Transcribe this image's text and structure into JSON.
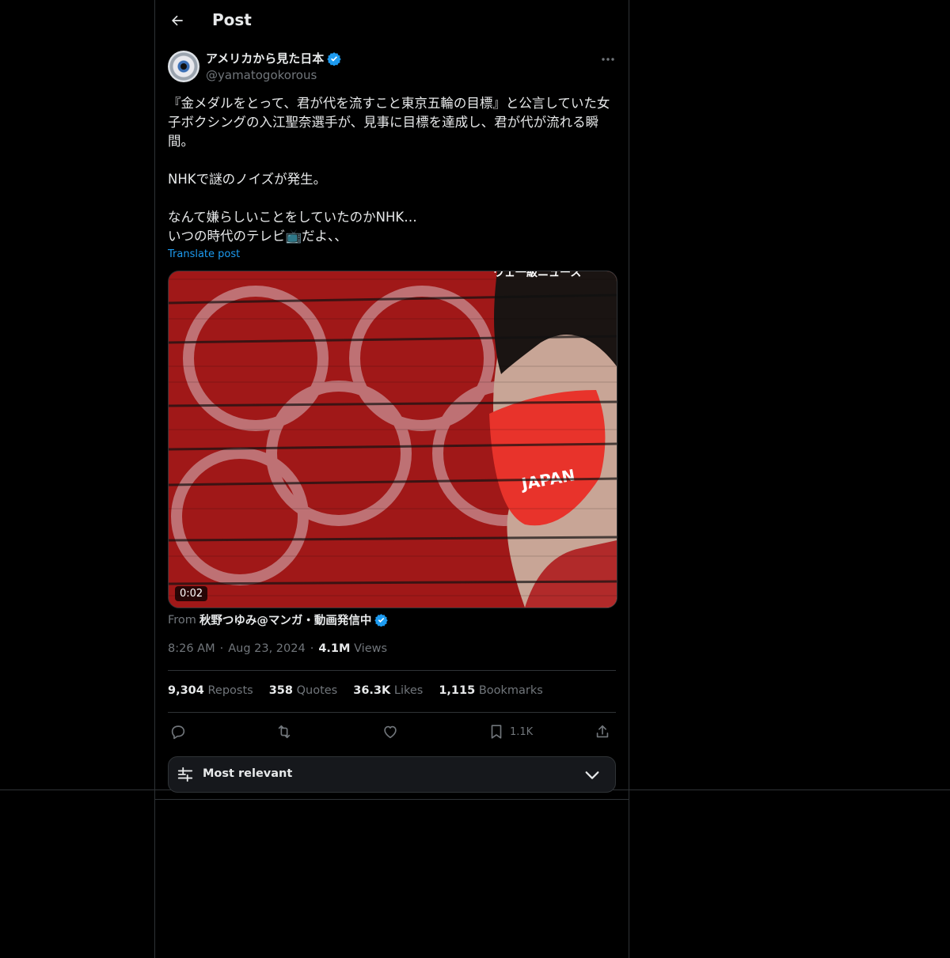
{
  "header": {
    "title": "Post"
  },
  "author": {
    "name": "アメリカから見た日本",
    "handle": "@yamatogokorous",
    "verified": true
  },
  "post": {
    "text": "『金メダルをとって、君が代を流すこと東京五輪の目標』と公言していた女子ボクシングの入江聖奈選手が、見事に目標を達成し、君が代が流れる瞬間。\n\nNHKで謎のノイズが発生。\n\nなんて嫌らしいことをしていたのかNHK…\nいつの時代のテレビ📺だよ、、",
    "translate_label": "Translate post"
  },
  "media": {
    "duration": "0:02",
    "mask_text": "JAPAN",
    "overlay_text": "ウェ一級ニュース"
  },
  "source": {
    "from_label": "From",
    "user": "秋野つゆみ@マンガ・動画発信中",
    "verified": true
  },
  "meta": {
    "time": "8:26 AM",
    "date": "Aug 23, 2024",
    "views_count": "4.1M",
    "views_label": "Views",
    "sep": "·"
  },
  "stats": [
    {
      "count": "9,304",
      "label": "Reposts"
    },
    {
      "count": "358",
      "label": "Quotes"
    },
    {
      "count": "36.3K",
      "label": "Likes"
    },
    {
      "count": "1,115",
      "label": "Bookmarks"
    }
  ],
  "actions": {
    "bookmark_count": "1.1K"
  },
  "sort": {
    "label": "Most relevant"
  },
  "colors": {
    "accent": "#1d9bf0",
    "background": "#000000",
    "text": "#e7e9ea",
    "muted": "#71767b",
    "border": "#2f3336"
  }
}
